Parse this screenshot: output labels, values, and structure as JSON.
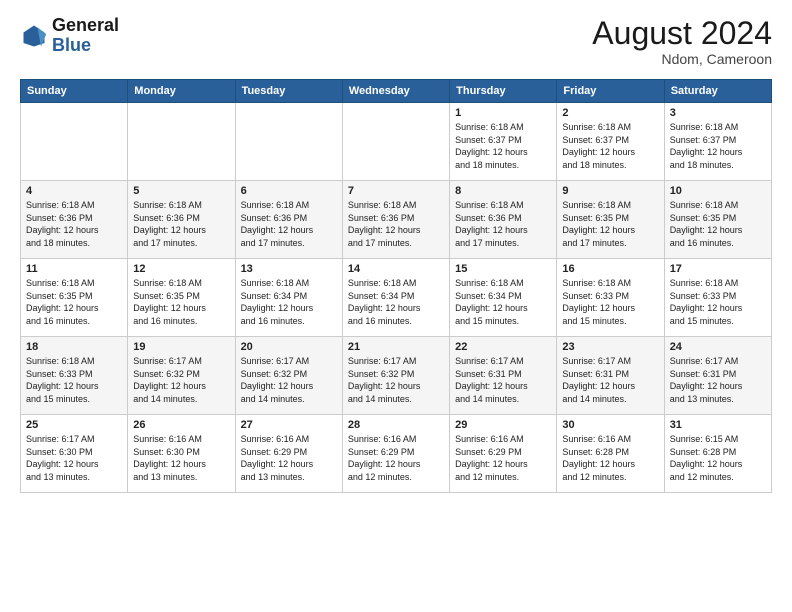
{
  "logo": {
    "line1": "General",
    "line2": "Blue"
  },
  "header": {
    "month_year": "August 2024",
    "location": "Ndom, Cameroon"
  },
  "days_of_week": [
    "Sunday",
    "Monday",
    "Tuesday",
    "Wednesday",
    "Thursday",
    "Friday",
    "Saturday"
  ],
  "weeks": [
    [
      {
        "day": "",
        "info": ""
      },
      {
        "day": "",
        "info": ""
      },
      {
        "day": "",
        "info": ""
      },
      {
        "day": "",
        "info": ""
      },
      {
        "day": "1",
        "info": "Sunrise: 6:18 AM\nSunset: 6:37 PM\nDaylight: 12 hours\nand 18 minutes."
      },
      {
        "day": "2",
        "info": "Sunrise: 6:18 AM\nSunset: 6:37 PM\nDaylight: 12 hours\nand 18 minutes."
      },
      {
        "day": "3",
        "info": "Sunrise: 6:18 AM\nSunset: 6:37 PM\nDaylight: 12 hours\nand 18 minutes."
      }
    ],
    [
      {
        "day": "4",
        "info": "Sunrise: 6:18 AM\nSunset: 6:36 PM\nDaylight: 12 hours\nand 18 minutes."
      },
      {
        "day": "5",
        "info": "Sunrise: 6:18 AM\nSunset: 6:36 PM\nDaylight: 12 hours\nand 17 minutes."
      },
      {
        "day": "6",
        "info": "Sunrise: 6:18 AM\nSunset: 6:36 PM\nDaylight: 12 hours\nand 17 minutes."
      },
      {
        "day": "7",
        "info": "Sunrise: 6:18 AM\nSunset: 6:36 PM\nDaylight: 12 hours\nand 17 minutes."
      },
      {
        "day": "8",
        "info": "Sunrise: 6:18 AM\nSunset: 6:36 PM\nDaylight: 12 hours\nand 17 minutes."
      },
      {
        "day": "9",
        "info": "Sunrise: 6:18 AM\nSunset: 6:35 PM\nDaylight: 12 hours\nand 17 minutes."
      },
      {
        "day": "10",
        "info": "Sunrise: 6:18 AM\nSunset: 6:35 PM\nDaylight: 12 hours\nand 16 minutes."
      }
    ],
    [
      {
        "day": "11",
        "info": "Sunrise: 6:18 AM\nSunset: 6:35 PM\nDaylight: 12 hours\nand 16 minutes."
      },
      {
        "day": "12",
        "info": "Sunrise: 6:18 AM\nSunset: 6:35 PM\nDaylight: 12 hours\nand 16 minutes."
      },
      {
        "day": "13",
        "info": "Sunrise: 6:18 AM\nSunset: 6:34 PM\nDaylight: 12 hours\nand 16 minutes."
      },
      {
        "day": "14",
        "info": "Sunrise: 6:18 AM\nSunset: 6:34 PM\nDaylight: 12 hours\nand 16 minutes."
      },
      {
        "day": "15",
        "info": "Sunrise: 6:18 AM\nSunset: 6:34 PM\nDaylight: 12 hours\nand 15 minutes."
      },
      {
        "day": "16",
        "info": "Sunrise: 6:18 AM\nSunset: 6:33 PM\nDaylight: 12 hours\nand 15 minutes."
      },
      {
        "day": "17",
        "info": "Sunrise: 6:18 AM\nSunset: 6:33 PM\nDaylight: 12 hours\nand 15 minutes."
      }
    ],
    [
      {
        "day": "18",
        "info": "Sunrise: 6:18 AM\nSunset: 6:33 PM\nDaylight: 12 hours\nand 15 minutes."
      },
      {
        "day": "19",
        "info": "Sunrise: 6:17 AM\nSunset: 6:32 PM\nDaylight: 12 hours\nand 14 minutes."
      },
      {
        "day": "20",
        "info": "Sunrise: 6:17 AM\nSunset: 6:32 PM\nDaylight: 12 hours\nand 14 minutes."
      },
      {
        "day": "21",
        "info": "Sunrise: 6:17 AM\nSunset: 6:32 PM\nDaylight: 12 hours\nand 14 minutes."
      },
      {
        "day": "22",
        "info": "Sunrise: 6:17 AM\nSunset: 6:31 PM\nDaylight: 12 hours\nand 14 minutes."
      },
      {
        "day": "23",
        "info": "Sunrise: 6:17 AM\nSunset: 6:31 PM\nDaylight: 12 hours\nand 14 minutes."
      },
      {
        "day": "24",
        "info": "Sunrise: 6:17 AM\nSunset: 6:31 PM\nDaylight: 12 hours\nand 13 minutes."
      }
    ],
    [
      {
        "day": "25",
        "info": "Sunrise: 6:17 AM\nSunset: 6:30 PM\nDaylight: 12 hours\nand 13 minutes."
      },
      {
        "day": "26",
        "info": "Sunrise: 6:16 AM\nSunset: 6:30 PM\nDaylight: 12 hours\nand 13 minutes."
      },
      {
        "day": "27",
        "info": "Sunrise: 6:16 AM\nSunset: 6:29 PM\nDaylight: 12 hours\nand 13 minutes."
      },
      {
        "day": "28",
        "info": "Sunrise: 6:16 AM\nSunset: 6:29 PM\nDaylight: 12 hours\nand 12 minutes."
      },
      {
        "day": "29",
        "info": "Sunrise: 6:16 AM\nSunset: 6:29 PM\nDaylight: 12 hours\nand 12 minutes."
      },
      {
        "day": "30",
        "info": "Sunrise: 6:16 AM\nSunset: 6:28 PM\nDaylight: 12 hours\nand 12 minutes."
      },
      {
        "day": "31",
        "info": "Sunrise: 6:15 AM\nSunset: 6:28 PM\nDaylight: 12 hours\nand 12 minutes."
      }
    ]
  ]
}
